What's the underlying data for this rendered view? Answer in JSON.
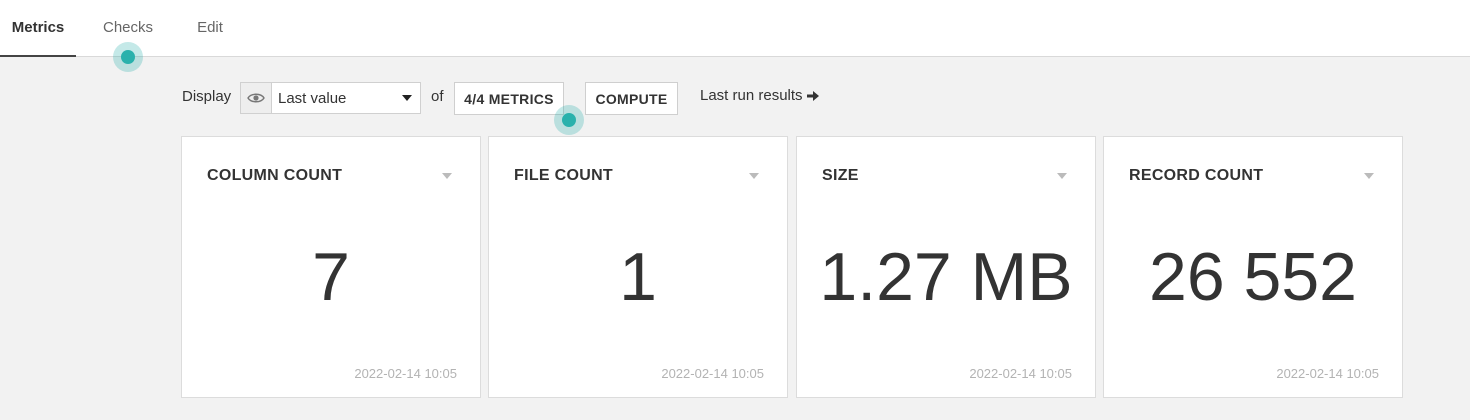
{
  "tabs": {
    "metrics": "Metrics",
    "checks": "Checks",
    "edit": "Edit"
  },
  "toolbar": {
    "display_label": "Display",
    "display_value": "Last value",
    "of_label": "of",
    "metrics_button": "4/4 METRICS",
    "compute_button": "COMPUTE",
    "last_run_link": "Last run results"
  },
  "cards": [
    {
      "title": "COLUMN COUNT",
      "value": "7",
      "timestamp": "2022-02-14 10:05"
    },
    {
      "title": "FILE COUNT",
      "value": "1",
      "timestamp": "2022-02-14 10:05"
    },
    {
      "title": "SIZE",
      "value": "1.27 MB",
      "timestamp": "2022-02-14 10:05"
    },
    {
      "title": "RECORD COUNT",
      "value": "26 552",
      "timestamp": "2022-02-14 10:05"
    }
  ],
  "icons": {
    "display_icon": "eye-icon",
    "select_caret": "caret-down-icon",
    "last_run_arrow": "arrow-right-icon",
    "card_menu": "caret-down-icon"
  },
  "colors": {
    "accent_hint": "#2ab1ac",
    "background": "#f2f2f2",
    "timestamp": "#b3b3b3"
  }
}
